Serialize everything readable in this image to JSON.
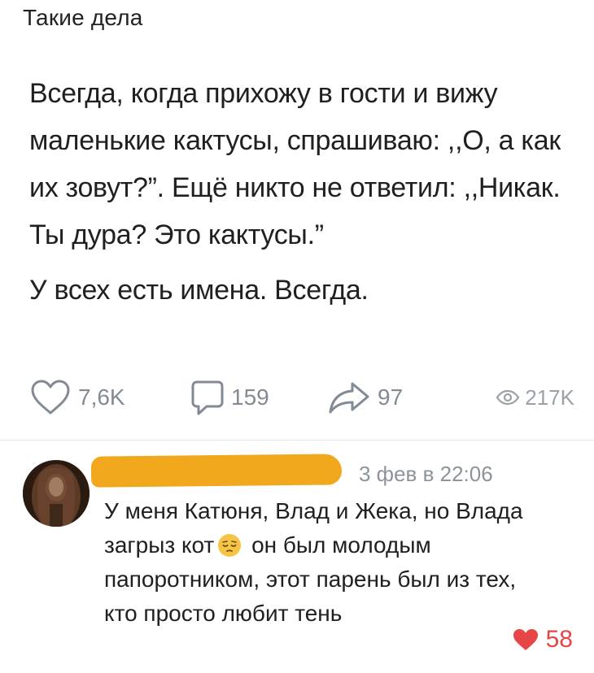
{
  "post": {
    "author_name": "Такие дела",
    "paragraphs": [
      "Всегда, когда прихожу в гости и вижу маленькие кактусы, спрашиваю: ,,О, а как их зовут?”. Ещё никто не ответил: ,,Никак. Ты дура? Это кактусы.”",
      "У всех есть имена. Всегда."
    ],
    "stats": {
      "likes": "7,6K",
      "comments": "159",
      "shares": "97",
      "views": "217K"
    }
  },
  "comment": {
    "date": "3 фев в 22:06",
    "text_before_emoji": "У меня Катюня, Влад и Жека, но Влада загрыз кот",
    "emoji": "pensive-face",
    "text_after_emoji": " он был молодым папоротником, этот парень был из тех, кто просто любит тень",
    "likes": "58"
  },
  "colors": {
    "accent_like": "#e64646",
    "icon_gray": "#828a94",
    "redaction": "#f2a81d"
  }
}
